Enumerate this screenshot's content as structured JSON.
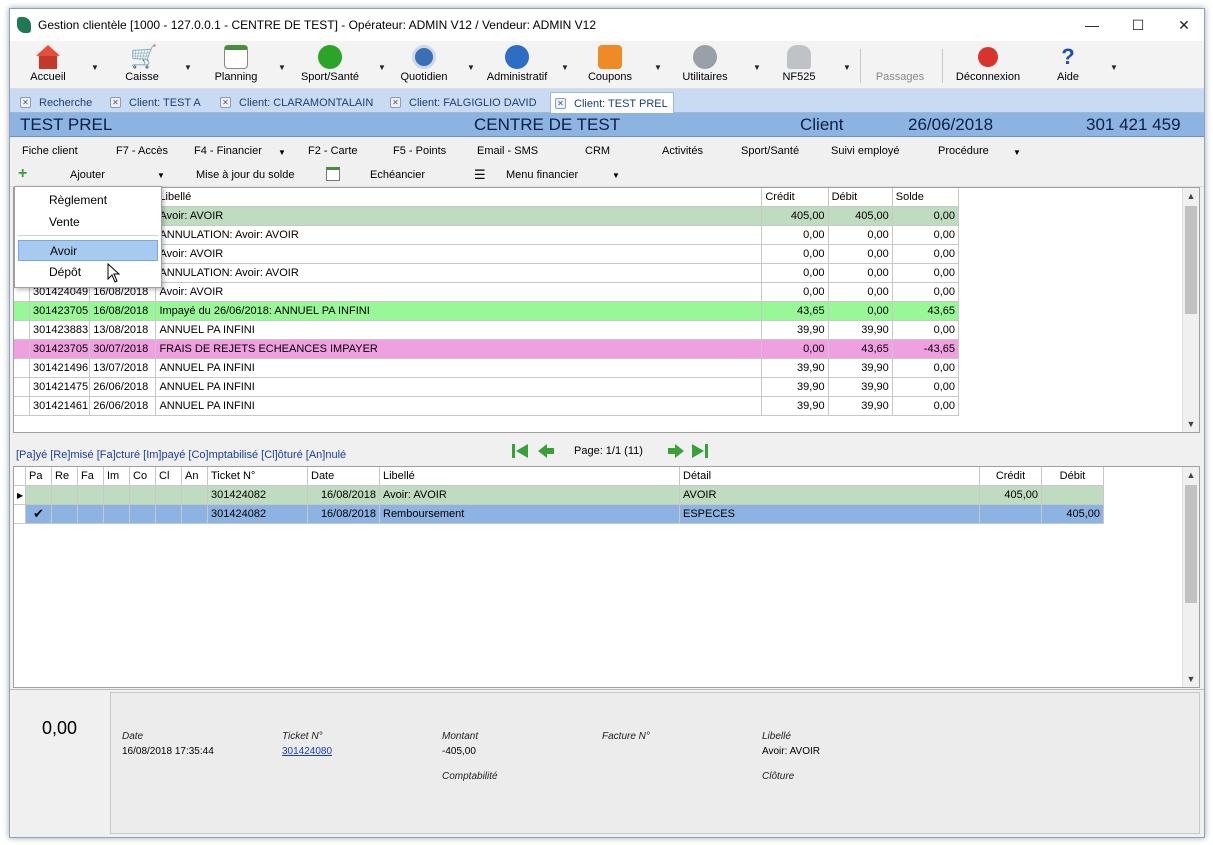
{
  "window": {
    "title": "Gestion clientèle [1000 - 127.0.0.1 - CENTRE DE TEST] - Opérateur: ADMIN V12 / Vendeur: ADMIN V12",
    "minimize": "—",
    "maximize": "☐",
    "close": "✕"
  },
  "toolbar": {
    "accueil": "Accueil",
    "caisse": "Caisse",
    "planning": "Planning",
    "sport": "Sport/Santé",
    "quotidien": "Quotidien",
    "administratif": "Administratif",
    "coupons": "Coupons",
    "utilitaires": "Utilitaires",
    "nf525": "NF525",
    "passages": "Passages",
    "deconnexion": "Déconnexion",
    "aide": "Aide"
  },
  "tabs": [
    "Recherche",
    "Client: TEST A",
    "Client: CLARAMONTALAIN",
    "Client: FALGIGLIO DAVID",
    "Client: TEST PREL"
  ],
  "header": {
    "name": "TEST PREL",
    "center": "CENTRE DE TEST",
    "type": "Client",
    "date": "26/06/2018",
    "number": "301 421 459"
  },
  "menu": [
    "Fiche client",
    "F7 - Accès",
    "F4 - Financier",
    "F2 - Carte",
    "F5 - Points",
    "Email - SMS",
    "CRM",
    "Activités",
    "Sport/Santé",
    "Suivi employé",
    "Procédure"
  ],
  "actions": {
    "add": "Ajouter",
    "update": "Mise à jour du solde",
    "schedule": "Echéancier",
    "fin_menu": "Menu financier"
  },
  "dropdown": [
    "Règlement",
    "Vente",
    "Avoir",
    "Dépôt"
  ],
  "grid1": {
    "headers": {
      "libelle": "Libellé",
      "credit": "Crédit",
      "debit": "Débit",
      "solde": "Solde"
    },
    "rows": [
      {
        "ticket": "",
        "date": "",
        "libelle": "Avoir: AVOIR",
        "credit": "405,00",
        "debit": "405,00",
        "solde": "0,00",
        "bg": "#c0dcc0"
      },
      {
        "ticket": "",
        "date": "",
        "libelle": "ANNULATION: Avoir: AVOIR",
        "credit": "0,00",
        "debit": "0,00",
        "solde": "0,00",
        "bg": "#ffffff"
      },
      {
        "ticket": "",
        "date": "",
        "libelle": "Avoir: AVOIR",
        "credit": "0,00",
        "debit": "0,00",
        "solde": "0,00",
        "bg": "#ffffff"
      },
      {
        "ticket": "",
        "date": "",
        "libelle": "ANNULATION: Avoir: AVOIR",
        "credit": "0,00",
        "debit": "0,00",
        "solde": "0,00",
        "bg": "#ffffff"
      },
      {
        "ticket": "301424049",
        "date": "16/08/2018",
        "libelle": "Avoir: AVOIR",
        "credit": "0,00",
        "debit": "0,00",
        "solde": "0,00",
        "bg": "#ffffff"
      },
      {
        "ticket": "301423705",
        "date": "16/08/2018",
        "libelle": "Impayé du 26/06/2018: ANNUEL PA INFINI",
        "credit": "43,65",
        "debit": "0,00",
        "solde": "43,65",
        "bg": "#98f898"
      },
      {
        "ticket": "301423883",
        "date": "13/08/2018",
        "libelle": "ANNUEL PA INFINI",
        "credit": "39,90",
        "debit": "39,90",
        "solde": "0,00",
        "bg": "#ffffff"
      },
      {
        "ticket": "301423705",
        "date": "30/07/2018",
        "libelle": "FRAIS DE REJETS ECHEANCES IMPAYER",
        "credit": "0,00",
        "debit": "43,65",
        "solde": "-43,65",
        "bg": "#f0a0e0"
      },
      {
        "ticket": "301421496",
        "date": "13/07/2018",
        "libelle": "ANNUEL PA INFINI",
        "credit": "39,90",
        "debit": "39,90",
        "solde": "0,00",
        "bg": "#ffffff"
      },
      {
        "ticket": "301421475",
        "date": "26/06/2018",
        "libelle": "ANNUEL PA INFINI",
        "credit": "39,90",
        "debit": "39,90",
        "solde": "0,00",
        "bg": "#ffffff"
      },
      {
        "ticket": "301421461",
        "date": "26/06/2018",
        "libelle": "ANNUEL PA INFINI",
        "credit": "39,90",
        "debit": "39,90",
        "solde": "0,00",
        "bg": "#ffffff"
      }
    ]
  },
  "legend": "[Pa]yé [Re]misé [Fa]cturé [Im]payé [Co]mptabilisé [Cl]ôturé [An]nulé",
  "pager": {
    "text": "Page: 1/1 (11)"
  },
  "grid2": {
    "headers": [
      "Pa",
      "Re",
      "Fa",
      "Im",
      "Co",
      "Cl",
      "An",
      "Ticket N°",
      "Date",
      "Libellé",
      "Détail",
      "Crédit",
      "Débit"
    ],
    "rows": [
      {
        "check": "",
        "ticket": "301424082",
        "date": "16/08/2018",
        "libelle": "Avoir: AVOIR",
        "detail": "AVOIR",
        "credit": "405,00",
        "debit": "",
        "bg": "#c0dcc0"
      },
      {
        "check": "✔",
        "ticket": "301424082",
        "date": "16/08/2018",
        "libelle": "Remboursement",
        "detail": "ESPECES",
        "credit": "",
        "debit": "405,00",
        "bg": "#8db3e2"
      }
    ]
  },
  "bottom": {
    "balance": "0,00",
    "date_label": "Date",
    "date_value": "16/08/2018 17:35:44",
    "ticket_label": "Ticket N°",
    "ticket_value": "301424080",
    "montant_label": "Montant",
    "montant_value": "-405,00",
    "compta_label": "Comptabilité",
    "facture_label": "Facture N°",
    "libelle_label": "Libellé",
    "libelle_value": "Avoir: AVOIR",
    "cloture_label": "Clôture"
  }
}
